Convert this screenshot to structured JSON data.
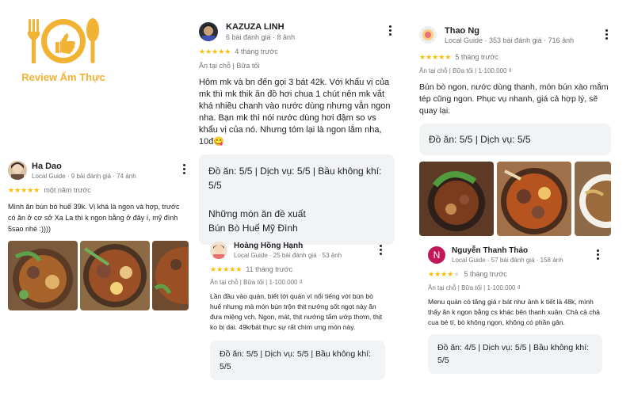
{
  "logo": {
    "text": "Review Ẩm Thực",
    "color": "#f2b233"
  },
  "reviews": [
    {
      "name": "Ha Dao",
      "meta": "Local Guide · 9 bài đánh giá · 74 ảnh",
      "rating": 5,
      "time": "một năm trước",
      "text": "Mình ăn bún bò huế 39k. Vị khá là ngon và hợp, trước có ăn ở cơ sở Xa La thì k ngon bằng ở đây í, mỹ đình 5sao nhé :))))"
    },
    {
      "name": "KAZUZA LINH",
      "meta": "6 bài đánh giá · 8 ảnh",
      "rating": 5,
      "time": "4 tháng trước",
      "tags": "Ăn tại chỗ  |  Bữa tối",
      "text": "Hôm mk và bn đến gọi 3 bát 42k. Với khẩu vị của mk thì mk thik ăn đồ hơi chua 1 chút nên mk vắt khá nhiều chanh vào nước dùng nhưng vẫn ngon nha. Bạn mk thì nói nước dùng hơi đậm so vs khẩu vị của nó. Nhưng tóm lại là ngon lắm nha, 10đ😋",
      "ratings_line": "Đồ ăn: 5/5  |  Dịch vụ: 5/5  |  Bầu không khí: 5/5",
      "dishes_title": "Những món ăn đề xuất",
      "dishes": "Bún Bò Huế Mỹ Đình"
    },
    {
      "name": "Hoàng Hồng Hạnh",
      "meta": "Local Guide · 25 bài đánh giá · 53 ảnh",
      "rating": 5,
      "time": "11 tháng trước",
      "tags": "Ăn tại chỗ  |  Bữa tối  |  1-100.000 ₫",
      "text": "Lần đầu vào quán, biết tới quán vì nổi tiếng với bún bò huế nhưng mà món bún trộn thịt nướng sốt ngọt này ăn đưa miệng vch. Ngon, mát, thịt nướng tẩm ướp thơm, thịt ko bị dai. 49k/bát thực sự rất chìm ưng món này.",
      "ratings_line": "Đồ ăn: 5/5  |  Dịch vụ: 5/5  |  Bầu không khí: 5/5"
    },
    {
      "name": "Thao Ng",
      "meta": "Local Guide · 353 bài đánh giá · 716 ảnh",
      "rating": 5,
      "time": "5 tháng trước",
      "tags": "Ăn tại chỗ  |  Bữa tối  |  1-100.000 ₫",
      "text": "Bún bò ngon, nước dùng thanh, món bún xào mắm tép cũng ngon. Phục vụ nhanh, giá cả hợp lý, sẽ quay lại.",
      "ratings_line": "Đồ ăn: 5/5  |  Dịch vụ: 5/5"
    },
    {
      "name": "Nguyễn Thanh Thảo",
      "initial": "N",
      "meta": "Local Guide · 57 bài đánh giá · 158 ảnh",
      "rating": 4,
      "time": "5 tháng trước",
      "tags": "Ăn tại chỗ  |  Bữa tối  |  1-100.000 ₫",
      "text": "Menu quán có tăng giá r bát như ảnh k tiết là 48k, mình thấy ăn k ngon bằng cs khác bên thanh xuân. Chả cả chả cua bé tí, bò không ngon, không có phần gân.",
      "ratings_line": "Đồ ăn: 4/5  |  Dịch vụ: 5/5  |  Bầu không khí: 5/5"
    }
  ]
}
